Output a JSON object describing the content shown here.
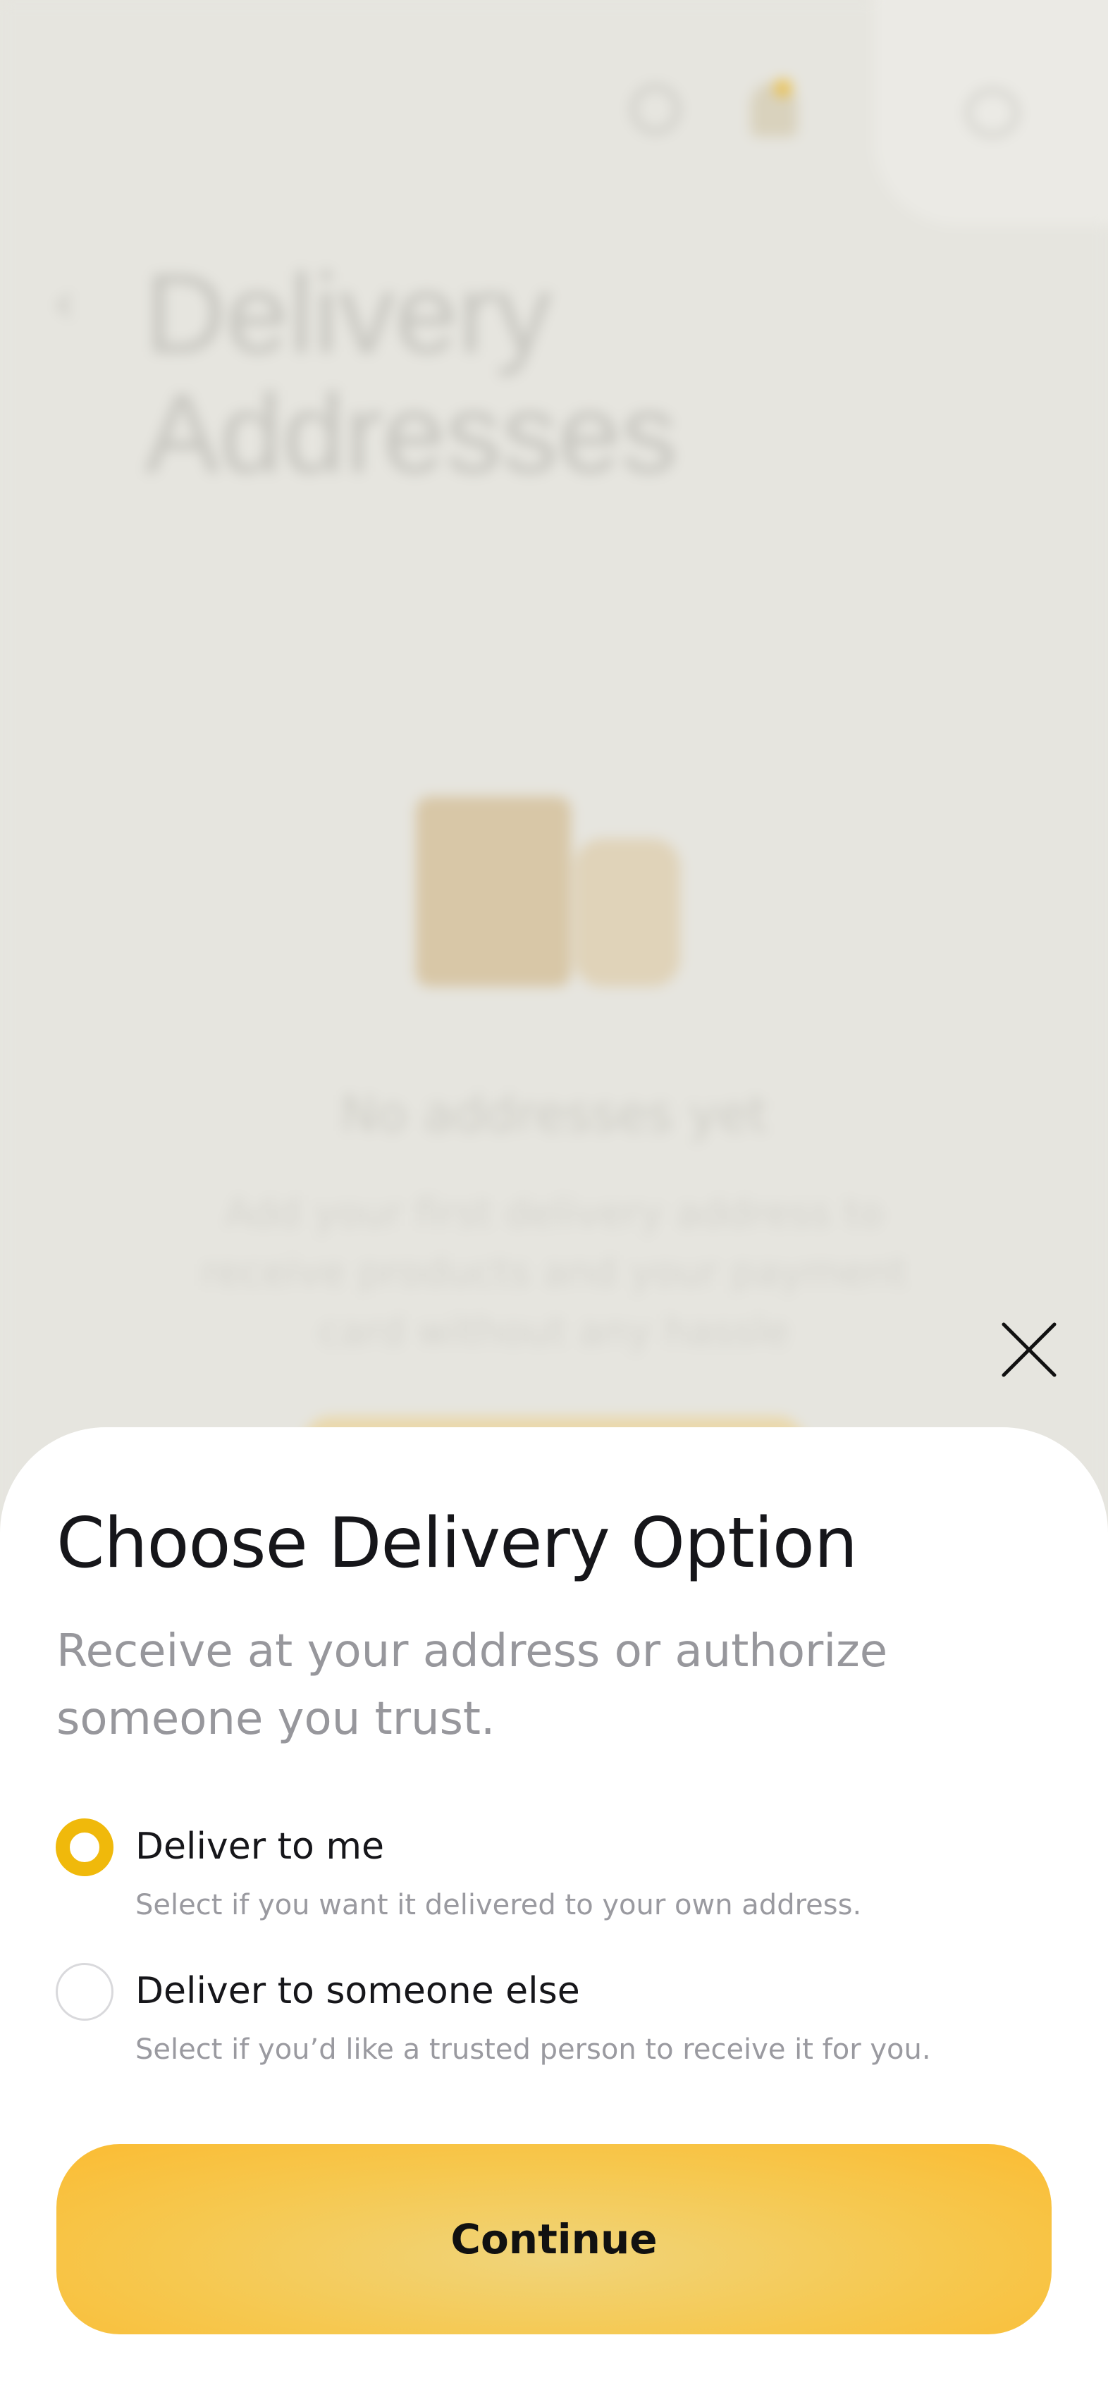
{
  "background": {
    "title": "Delivery\nAddresses",
    "empty_heading": "No addresses yet",
    "empty_text": "Add your first delivery address to receive products and your payment card without any hassle"
  },
  "sheet": {
    "title": "Choose Delivery Option",
    "subtitle": "Receive at your address or authorize someone you trust.",
    "options": [
      {
        "label": "Deliver to me",
        "description": "Select if you want it delivered to your own address.",
        "selected": true
      },
      {
        "label": "Deliver to someone else",
        "description": "Select if you’d like a trusted person to receive it for you.",
        "selected": false
      }
    ],
    "continue_label": "Continue"
  },
  "colors": {
    "accent": "#f0b90b",
    "button": "#f6c84f",
    "overlay": "#e6e5df"
  },
  "icons": {
    "close": "close-icon",
    "search": "search-icon",
    "notifications": "bell-icon",
    "profile": "profile-icon",
    "back": "back-icon"
  }
}
